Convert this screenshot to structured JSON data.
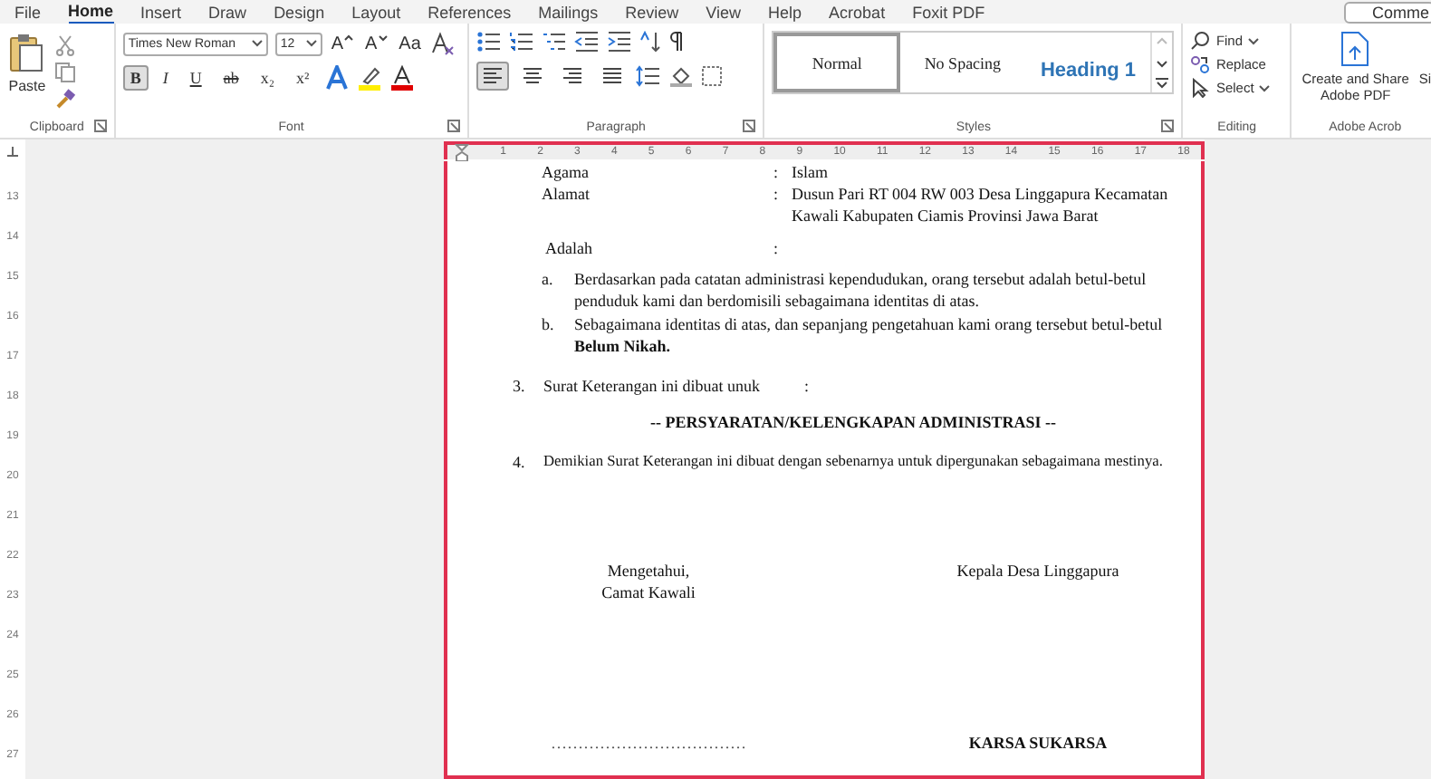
{
  "menu_tabs": [
    {
      "label": "File",
      "selected": false
    },
    {
      "label": "Home",
      "selected": true
    },
    {
      "label": "Insert",
      "selected": false
    },
    {
      "label": "Draw",
      "selected": false
    },
    {
      "label": "Design",
      "selected": false
    },
    {
      "label": "Layout",
      "selected": false
    },
    {
      "label": "References",
      "selected": false
    },
    {
      "label": "Mailings",
      "selected": false
    },
    {
      "label": "Review",
      "selected": false
    },
    {
      "label": "View",
      "selected": false
    },
    {
      "label": "Help",
      "selected": false
    },
    {
      "label": "Acrobat",
      "selected": false
    },
    {
      "label": "Foxit PDF",
      "selected": false
    }
  ],
  "comments_button": "Comme",
  "clipboard": {
    "paste": "Paste",
    "label": "Clipboard"
  },
  "font": {
    "name": "Times New Roman",
    "size": "12",
    "label": "Font",
    "grow": "A",
    "shrink": "A",
    "change_case": "Aa",
    "buttons": [
      {
        "label": "B",
        "selected": true
      },
      {
        "label": "I",
        "selected": false
      },
      {
        "label": "U",
        "selected": false
      },
      {
        "label": "ab",
        "selected": false
      },
      {
        "label": "x₂",
        "selected": false
      },
      {
        "label": "x²",
        "selected": false
      }
    ]
  },
  "paragraph": {
    "label": "Paragraph",
    "alignments": [
      {
        "selected": true
      },
      {
        "selected": false
      },
      {
        "selected": false
      },
      {
        "selected": false
      }
    ]
  },
  "styles": {
    "label": "Styles",
    "items": [
      {
        "label": "Normal",
        "kind": "normal",
        "selected": true
      },
      {
        "label": "No Spacing",
        "kind": "normal",
        "selected": false
      },
      {
        "label": "Heading 1",
        "kind": "heading",
        "selected": false
      }
    ]
  },
  "editing": {
    "label": "Editing",
    "find": "Find",
    "replace": "Replace",
    "select": "Select"
  },
  "acrobat": {
    "create": "Create and Share Adobe PDF",
    "cut_item": "Si",
    "label": "Adobe Acrob"
  },
  "horizontal_ruler": [
    "1",
    "2",
    "3",
    "4",
    "5",
    "6",
    "7",
    "8",
    "9",
    "10",
    "11",
    "12",
    "13",
    "14",
    "15",
    "16",
    "17",
    "18"
  ],
  "vertical_ruler": [
    "13",
    "14",
    "15",
    "16",
    "17",
    "18",
    "19",
    "20",
    "21",
    "22",
    "23",
    "24",
    "25",
    "26",
    "27"
  ],
  "document": {
    "fields": [
      {
        "label": "Agama",
        "value": "Islam"
      },
      {
        "label": "Alamat",
        "value": "Dusun Pari RT 004 RW 003  Desa Linggapura Kecamatan Kawali Kabupaten Ciamis Provinsi Jawa Barat"
      },
      {
        "label": "Adalah"
      }
    ],
    "colon": ":",
    "sub_items": [
      {
        "marker": "a.",
        "text": "Berdasarkan pada catatan administrasi kependudukan, orang tersebut adalah betul-betul penduduk kami dan berdomisili sebagaimana identitas di atas."
      },
      {
        "marker": "b.",
        "text": "Sebagaimana identitas di atas, dan sepanjang pengetahuan kami orang tersebut betul-betul **Belum Nikah.**"
      }
    ],
    "item_3": {
      "number": "3.",
      "text": "Surat Keterangan ini dibuat unuk",
      "colon": ":"
    },
    "heading": "-- PERSYARATAN/KELENGKAPAN ADMINISTRASI --",
    "item_4": {
      "number": "4.",
      "text": "Demikian Surat Keterangan ini dibuat dengan sebenarnya untuk dipergunakan sebagaimana mestinya."
    },
    "left_signature": {
      "lines": [
        "Mengetahui,",
        "Camat Kawali"
      ],
      "name": "………………………………"
    },
    "right_signature": {
      "lines": [
        "Kepala Desa Linggapura"
      ],
      "name": "KARSA SUKARSA"
    }
  }
}
